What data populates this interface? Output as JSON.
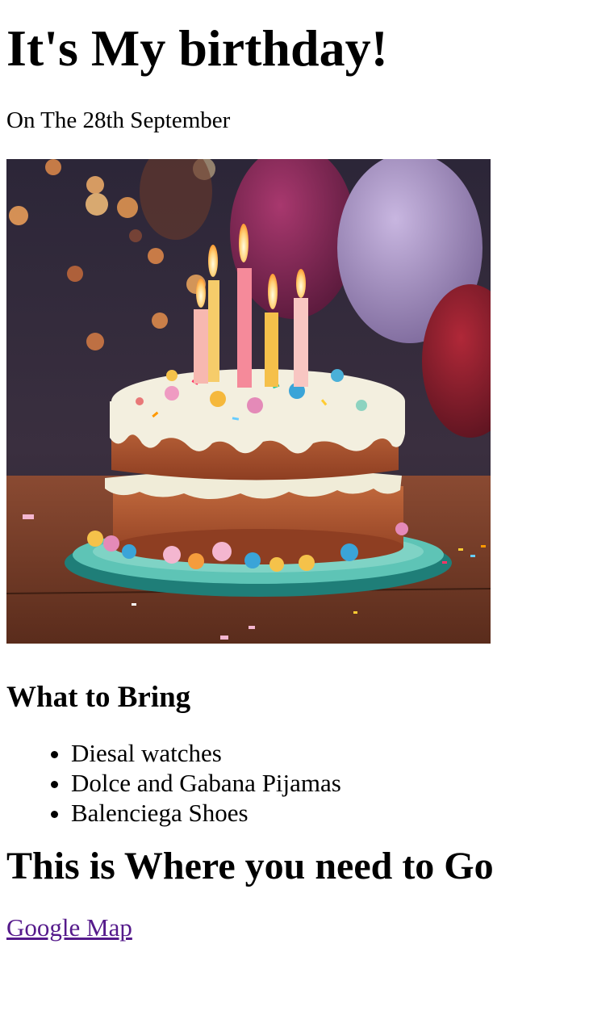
{
  "page": {
    "title": "It's My birthday!",
    "date_line": "On The 28th September"
  },
  "image": {
    "subject": "birthday-cake-with-candles-and-balloons"
  },
  "bring": {
    "heading": "What to Bring",
    "items": [
      "Diesal watches",
      "Dolce and Gabana Pijamas",
      "Balenciega Shoes"
    ]
  },
  "location": {
    "heading": "This is Where you need to Go",
    "link_text": "Google Map"
  },
  "colors": {
    "link_visited": "#551a8b",
    "text": "#000000",
    "background": "#ffffff"
  }
}
